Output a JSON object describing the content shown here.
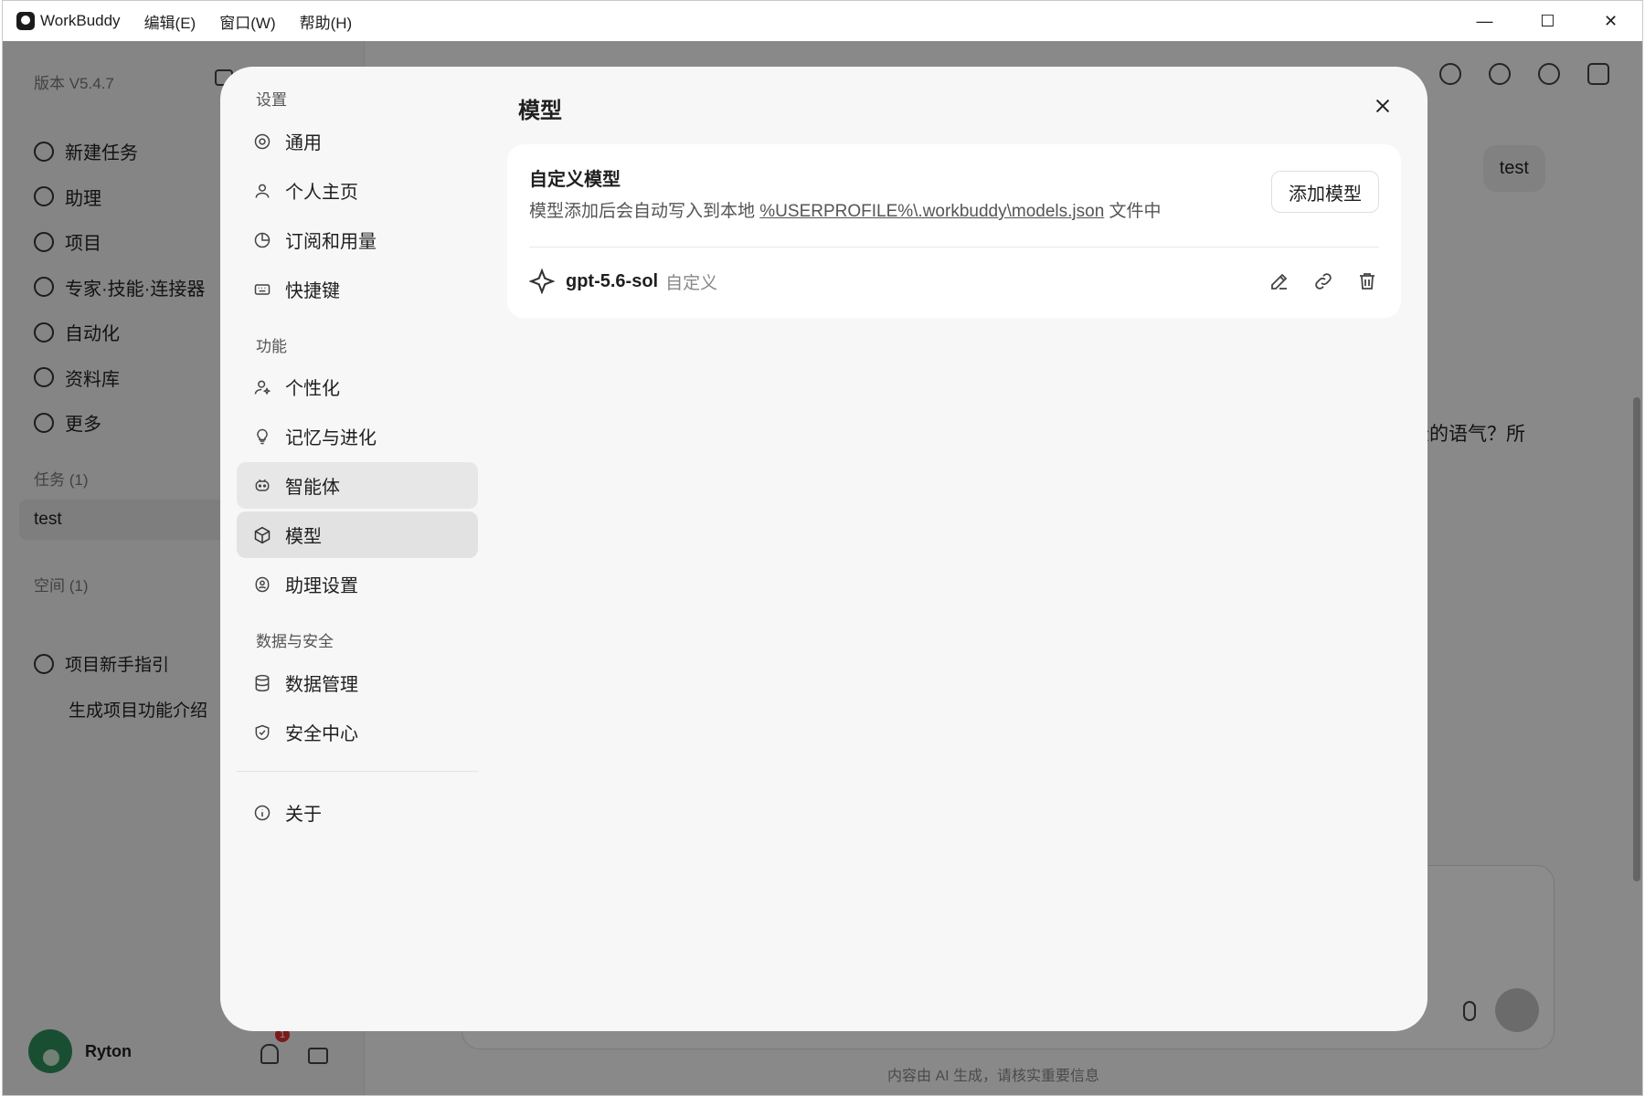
{
  "titlebar": {
    "app_name": "WorkBuddy",
    "menus": [
      "编辑(E)",
      "窗口(W)",
      "帮助(H)"
    ],
    "controls": {
      "minimize": "—",
      "maximize": "☐",
      "close": "✕"
    }
  },
  "sidebar": {
    "version": "版本 V5.4.7",
    "nav": [
      {
        "label": "新建任务",
        "icon": "plus-circle-icon"
      },
      {
        "label": "助理",
        "icon": "assistant-icon"
      },
      {
        "label": "项目",
        "icon": "project-icon"
      },
      {
        "label": "专家·技能·连接器",
        "icon": "expert-icon"
      },
      {
        "label": "自动化",
        "icon": "automation-icon"
      },
      {
        "label": "资料库",
        "icon": "library-icon"
      },
      {
        "label": "更多",
        "icon": "more-icon"
      }
    ],
    "tasks_label": "任务 (1)",
    "task_item": "test",
    "spaces_label": "空间 (1)",
    "space_item": "项目新手指引",
    "space_sub_item": "生成项目功能介绍",
    "user_name": "Ryton",
    "notification_count": "1"
  },
  "main": {
    "user_message": "test",
    "assistant_fragment": "松的语气？所",
    "footer_note": "内容由 AI 生成，请核实重要信息"
  },
  "settings": {
    "groups": {
      "settings": "设置",
      "features": "功能",
      "data_security": "数据与安全"
    },
    "items": {
      "general": "通用",
      "profile": "个人主页",
      "subscription": "订阅和用量",
      "shortcuts": "快捷键",
      "personalization": "个性化",
      "memory": "记忆与进化",
      "agents": "智能体",
      "models": "模型",
      "assistant_settings": "助理设置",
      "data_management": "数据管理",
      "security_center": "安全中心",
      "about": "关于"
    },
    "active_item": "模型",
    "content": {
      "title": "模型",
      "card_title": "自定义模型",
      "card_desc_prefix": "模型添加后会自动写入到本地 ",
      "card_desc_path": "%USERPROFILE%\\.workbuddy\\models.json",
      "card_desc_suffix": " 文件中",
      "add_button": "添加模型",
      "models": [
        {
          "name": "gpt-5.6-sol",
          "tag": "自定义"
        }
      ]
    }
  }
}
